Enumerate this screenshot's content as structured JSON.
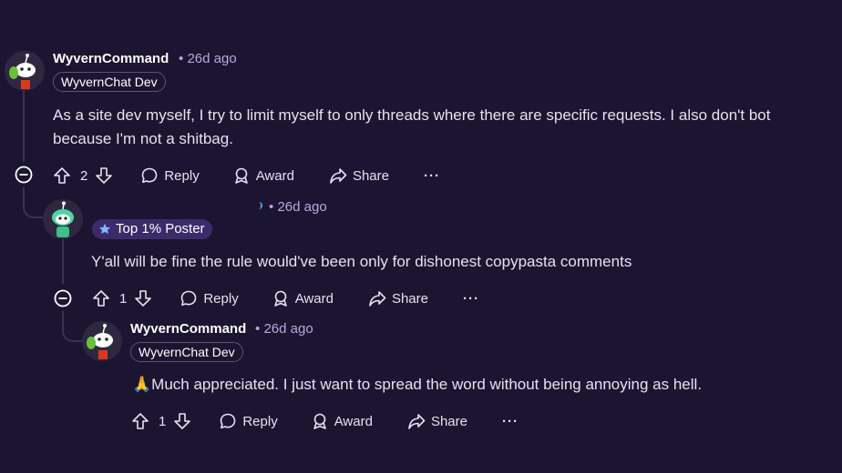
{
  "comments": [
    {
      "username": "WyvernCommand",
      "time": "26d ago",
      "flair": "WyvernChat Dev",
      "text_line1": "As a site dev myself, I try to limit myself to only threads where there are specific requests. I also don't bot",
      "text_line2": "because I'm not a shitbag.",
      "votes": "2",
      "reply_label": "Reply",
      "award_label": "Award",
      "share_label": "Share",
      "more": "···"
    },
    {
      "time": "26d ago",
      "achievement": "Top 1% Poster",
      "text": "Y'all will be fine the rule would've been only for dishonest copypasta comments",
      "votes": "1",
      "reply_label": "Reply",
      "award_label": "Award",
      "share_label": "Share",
      "more": "···"
    },
    {
      "username": "WyvernCommand",
      "time": "26d ago",
      "flair": "WyvernChat Dev",
      "emoji": "🙏",
      "text": "Much appreciated. I just want to spread the word without being annoying as hell.",
      "votes": "1",
      "reply_label": "Reply",
      "award_label": "Award",
      "share_label": "Share",
      "more": "···"
    }
  ],
  "separator": "•",
  "colors": {
    "background": "#1c1531",
    "meta": "#b8a8dd",
    "achievement_bg": "#3b2b6b",
    "thread_line": "#3a3350"
  },
  "icons": [
    "collapse-icon",
    "upvote-icon",
    "downvote-icon",
    "reply-icon",
    "award-icon",
    "share-icon",
    "more-icon",
    "achievement-icon"
  ]
}
